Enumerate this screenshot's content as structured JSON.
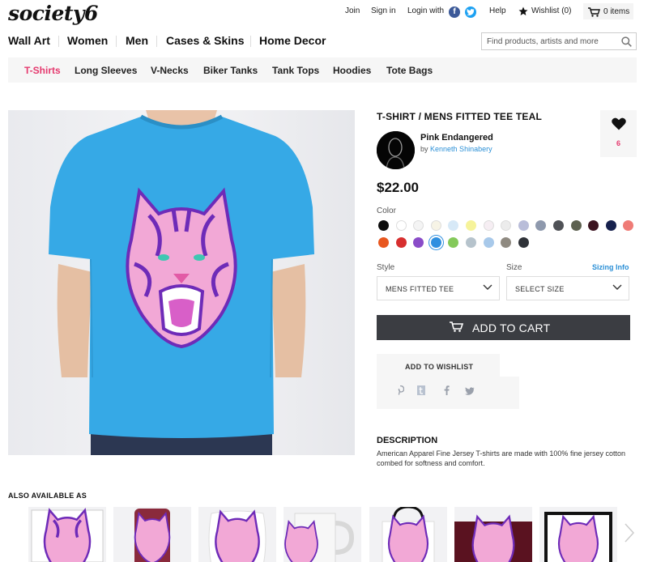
{
  "header": {
    "logo": "society6",
    "join": "Join",
    "sign_in": "Sign in",
    "login_with": "Login with",
    "facebook_icon_letter": "f",
    "help": "Help",
    "wishlist": "Wishlist (0)",
    "cart": "0 items"
  },
  "nav": {
    "items": [
      "Wall Art",
      "Women",
      "Men",
      "Cases & Skins",
      "Home Decor"
    ],
    "search_placeholder": "Find products, artists and more"
  },
  "subnav": {
    "items": [
      "T-Shirts",
      "Long Sleeves",
      "V-Necks",
      "Biker Tanks",
      "Tank Tops",
      "Hoodies",
      "Tote Bags"
    ],
    "active": "T-Shirts"
  },
  "product": {
    "title": "T-SHIRT / MENS FITTED TEE TEAL",
    "favorites": "6",
    "artwork_name": "Pink Endangered",
    "by": "by",
    "artist": "Kenneth Shinabery",
    "price": "$22.00",
    "color_label": "Color",
    "colors": [
      "#0d0d0d",
      "#ffffff",
      "#f4f4f4",
      "#f7f4e6",
      "#d7e9f7",
      "#f6f39a",
      "#f6eef3",
      "#ececec",
      "#b9bdd9",
      "#8e99ad",
      "#505257",
      "#5d6150",
      "#3c1420",
      "#16214d",
      "#ef7b76",
      "#e8571f",
      "#d72f2f",
      "#8a4cc8",
      "#2f8fe0",
      "#84c95a",
      "#b6c3cc",
      "#a8c9ea",
      "#8f8a81",
      "#2f3238"
    ],
    "selected_color": "#2f8fe0",
    "style_label": "Style",
    "style_value": "MENS FITTED TEE",
    "size_label": "Size",
    "size_value": "SELECT SIZE",
    "sizing_info": "Sizing Info",
    "add_to_cart": "ADD TO CART",
    "add_to_wishlist": "ADD TO WISHLIST",
    "share_icons": [
      "pinterest-icon",
      "tumblr-icon",
      "facebook-icon",
      "twitter-icon"
    ],
    "description_heading": "DESCRIPTION",
    "description": "American Apparel Fine Jersey T-shirts are made with 100% fine jersey cotton combed for softness and comfort."
  },
  "also_available": {
    "heading": "ALSO AVAILABLE AS",
    "items": [
      "art-print",
      "iphone-case",
      "throw-pillow",
      "mug",
      "tote-bag",
      "rug",
      "framed-print"
    ]
  },
  "colors": {
    "accent": "#e5396e",
    "link": "#2a8fd6",
    "shirt": "#36a9e6",
    "button_dark": "#3b3d42"
  }
}
